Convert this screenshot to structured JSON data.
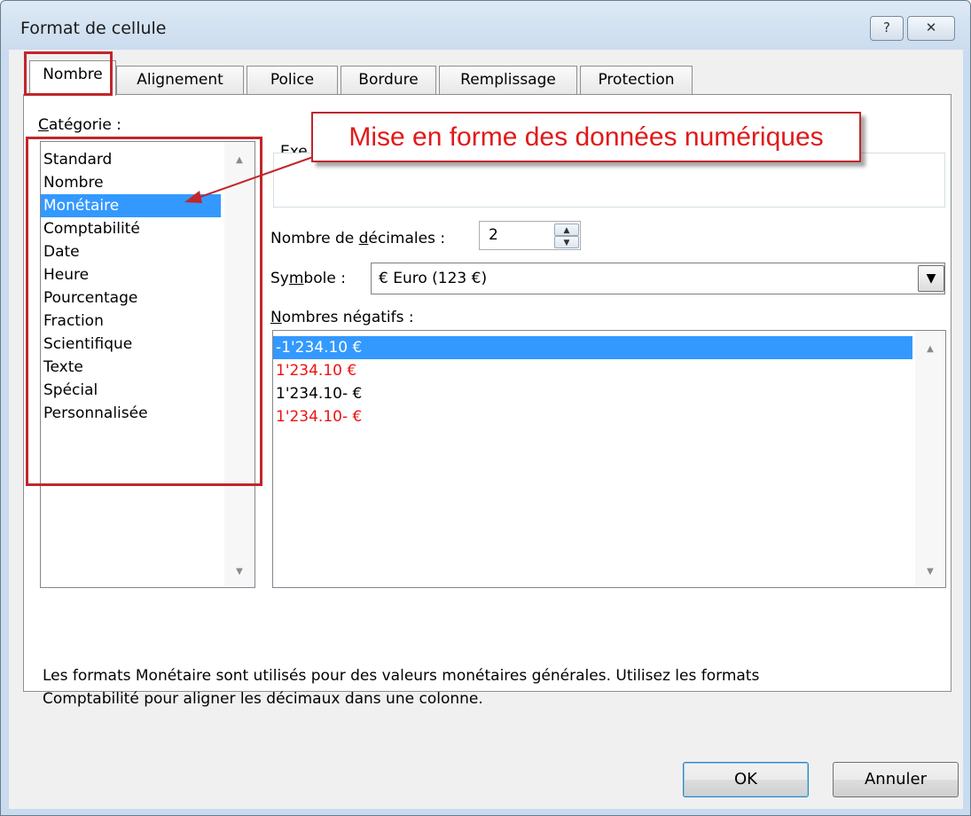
{
  "window": {
    "title": "Format de cellule",
    "help_glyph": "?",
    "close_glyph": "✕"
  },
  "tabs": [
    {
      "label": "Nombre",
      "active": true
    },
    {
      "label": "Alignement",
      "active": false
    },
    {
      "label": "Police",
      "active": false
    },
    {
      "label": "Bordure",
      "active": false
    },
    {
      "label": "Remplissage",
      "active": false
    },
    {
      "label": "Protection",
      "active": false
    }
  ],
  "category": {
    "label_prefix": "",
    "label_mnemonic": "C",
    "label_rest": "atégorie :",
    "items": [
      {
        "label": "Standard",
        "selected": false
      },
      {
        "label": "Nombre",
        "selected": false
      },
      {
        "label": "Monétaire",
        "selected": true
      },
      {
        "label": "Comptabilité",
        "selected": false
      },
      {
        "label": "Date",
        "selected": false
      },
      {
        "label": "Heure",
        "selected": false
      },
      {
        "label": "Pourcentage",
        "selected": false
      },
      {
        "label": "Fraction",
        "selected": false
      },
      {
        "label": "Scientifique",
        "selected": false
      },
      {
        "label": "Texte",
        "selected": false
      },
      {
        "label": "Spécial",
        "selected": false
      },
      {
        "label": "Personnalisée",
        "selected": false
      }
    ]
  },
  "example": {
    "label_partial": "Exe"
  },
  "decimals": {
    "label_prefix": "Nombre de ",
    "label_mnemonic": "d",
    "label_rest": "écimales :",
    "value": "2"
  },
  "symbol": {
    "label_prefix": "Sy",
    "label_mnemonic": "m",
    "label_rest": "bole :",
    "value": "€ Euro (123 €)"
  },
  "negatives": {
    "label_prefix": "",
    "label_mnemonic": "N",
    "label_rest": "ombres négatifs :",
    "items": [
      {
        "label": "-1'234.10 €",
        "selected": true,
        "red": false
      },
      {
        "label": "1'234.10 €",
        "selected": false,
        "red": true
      },
      {
        "label": "1'234.10- €",
        "selected": false,
        "red": false
      },
      {
        "label": "1'234.10- €",
        "selected": false,
        "red": true
      }
    ]
  },
  "description": {
    "line1": "Les formats Monétaire sont utilisés pour des valeurs monétaires générales. Utilisez les formats",
    "line2": "Comptabilité pour aligner les décimaux dans une colonne."
  },
  "annotation": {
    "callout_text": "Mise en forme des données numériques",
    "color": "#c0262b"
  },
  "buttons": {
    "ok": "OK",
    "cancel": "Annuler"
  },
  "colors": {
    "selection": "#3399ff",
    "negative_red": "#ee1111"
  }
}
